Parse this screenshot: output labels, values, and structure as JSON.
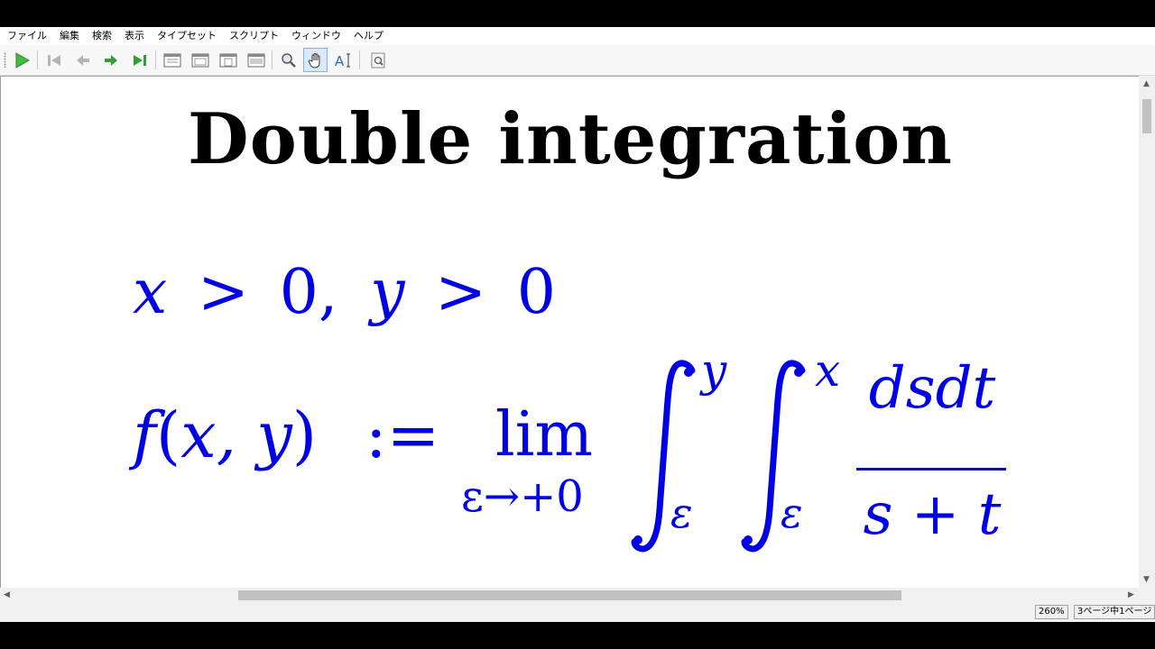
{
  "menu": {
    "items": [
      "ファイル",
      "編集",
      "検索",
      "表示",
      "タイプセット",
      "スクリプト",
      "ウィンドウ",
      "ヘルプ"
    ]
  },
  "toolbar": {
    "buttons": [
      {
        "name": "typeset-icon",
        "color": "#3cb043"
      },
      {
        "name": "first-page-icon",
        "color": "#b0b0b0"
      },
      {
        "name": "previous-page-icon",
        "color": "#b0b0b0"
      },
      {
        "name": "next-page-icon",
        "color": "#2e9e2e"
      },
      {
        "name": "last-page-icon",
        "color": "#2e9e2e"
      },
      {
        "name": "single-page-icon"
      },
      {
        "name": "continuous-page-icon"
      },
      {
        "name": "facing-pages-icon"
      },
      {
        "name": "fit-width-icon"
      },
      {
        "name": "magnify-icon"
      },
      {
        "name": "hand-tool-icon"
      },
      {
        "name": "text-select-icon"
      },
      {
        "name": "find-icon"
      }
    ]
  },
  "document": {
    "title": "Double integration",
    "math_color": "#0000e6",
    "condition": {
      "x": "x",
      "gt1": ">",
      "zero1": "0",
      "comma": ",",
      "y": "y",
      "gt2": ">",
      "zero2": "0"
    },
    "definition": {
      "f": "f",
      "open": "(",
      "args": "x, y",
      "close": ")",
      "assign": ":=",
      "lim": "lim",
      "lim_sub": "ε→+0",
      "int_upper_outer": "y",
      "int_lower_outer": "ε",
      "int_upper_inner": "x",
      "int_lower_inner": "ε",
      "numerator": "dsdt",
      "denominator": "s + t"
    }
  },
  "status": {
    "zoom": "260%",
    "page": "3ページ中1ページ"
  }
}
